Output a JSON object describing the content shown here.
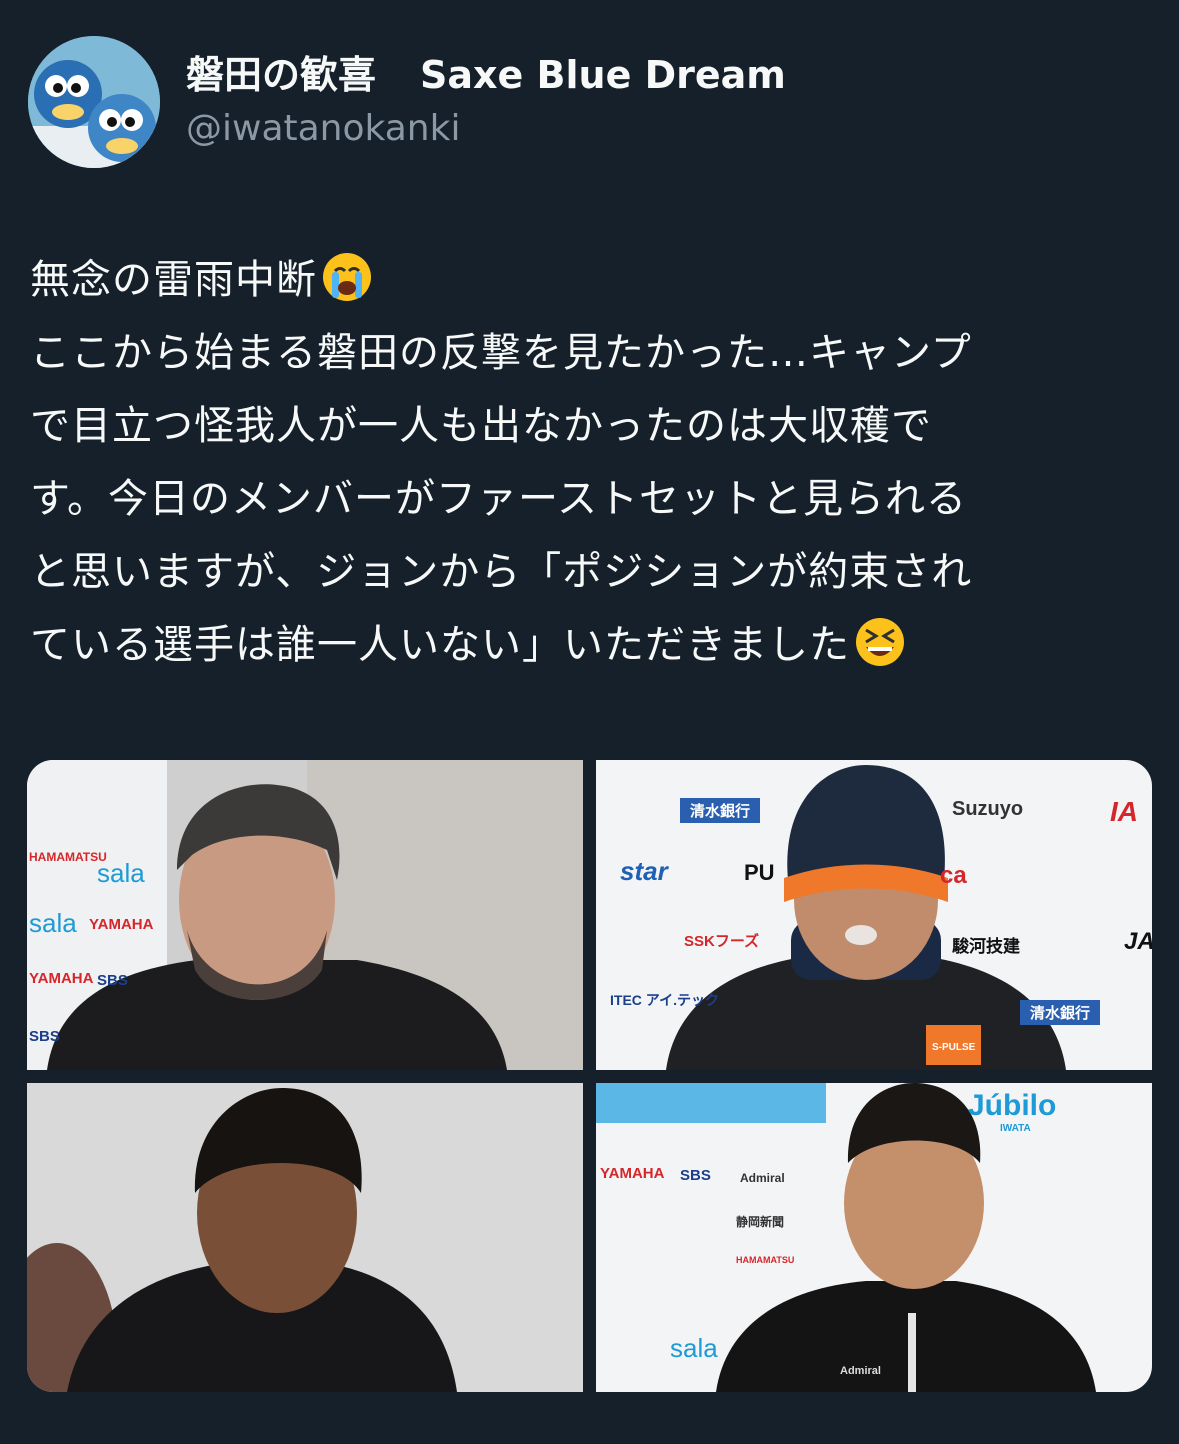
{
  "account": {
    "display_name_jp": "磐田の歓喜",
    "display_name_en": "Saxe Blue Dream",
    "handle": "@iwatanokanki",
    "avatar_icon": "mascot-avatar-icon"
  },
  "tweet": {
    "lines": [
      "無念の雷雨中断",
      "ここから始まる磐田の反撃を見たかった…キャンプ",
      "で目立つ怪我人が一人も出なかったのは大収穫で",
      "す。今日のメンバーがファーストセットと見られる",
      "と思いますが、ジョンから「ポジションが約束され",
      "ている選手は誰一人いない」いただきました"
    ],
    "emoji_1": "crying-face-emoji",
    "emoji_2": "grinning-squinting-face-emoji"
  },
  "photos": {
    "p1": {
      "sponsors": [
        "HAMAMATSU",
        "sala",
        "sala",
        "YAMAHA",
        "YAMAHA",
        "SBS",
        "SBS"
      ]
    },
    "p2": {
      "sponsors": [
        "清水銀行",
        "Suzuyo",
        "star",
        "PU",
        "ca",
        "SSKフーズ",
        "駿河技建",
        "ITEC アイ.テック",
        "清水銀行",
        "IA",
        "JA",
        "S-PULSE"
      ]
    },
    "p3": {
      "sponsors": []
    },
    "p4": {
      "sponsors": [
        "Júbilo",
        "IWATA",
        "YAMAHA",
        "SBS",
        "Admiral",
        "静岡新聞",
        "HAMAMATSU",
        "sala",
        "Admiral"
      ]
    }
  }
}
